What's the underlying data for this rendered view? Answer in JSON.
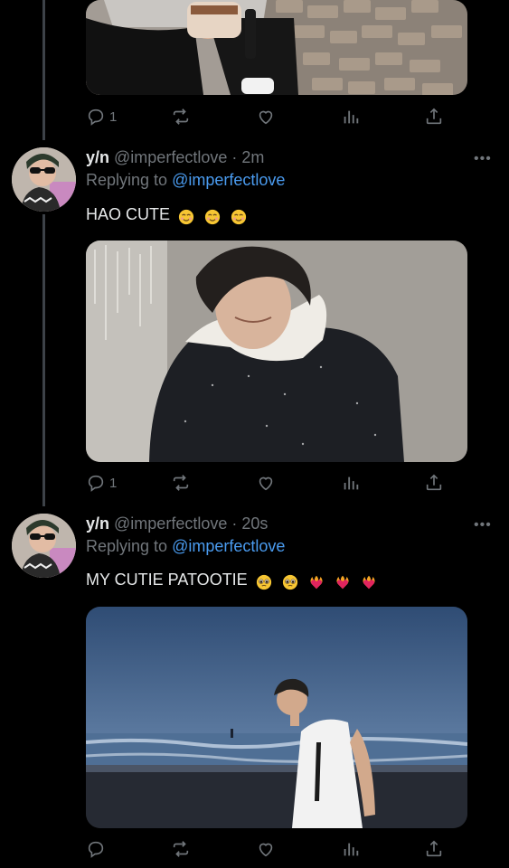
{
  "tweets": [
    {
      "image_alt": "person holding a coffee cup sitting on brick pavement",
      "actions": {
        "reply_count": "1"
      }
    },
    {
      "name": "y/n",
      "handle": "@imperfectlove",
      "time": "· 2m",
      "replying_prefix": "Replying to",
      "replying_to": "@imperfectlove",
      "text": "HAO CUTE",
      "emojis": [
        "relieved-face-emoji",
        "relieved-face-emoji",
        "relieved-face-emoji"
      ],
      "image_alt": "smiling person in a black puffer jacket against a grey wall",
      "actions": {
        "reply_count": "1"
      }
    },
    {
      "name": "y/n",
      "handle": "@imperfectlove",
      "time": "· 20s",
      "replying_prefix": "Replying to",
      "replying_to": "@imperfectlove",
      "text": "MY CUTIE PATOOTIE",
      "emojis": [
        "pleading-face-emoji",
        "pleading-face-emoji",
        "heart-on-fire-emoji",
        "heart-on-fire-emoji",
        "heart-on-fire-emoji"
      ],
      "image_alt": "person in a white t-shirt on a beach at dusk",
      "actions": {
        "reply_count": ""
      }
    }
  ],
  "colors": {
    "background": "#000000",
    "text": "#e7e9ea",
    "muted": "#71767b",
    "mention": "#4a9bef",
    "thread_line": "#3d4248"
  }
}
